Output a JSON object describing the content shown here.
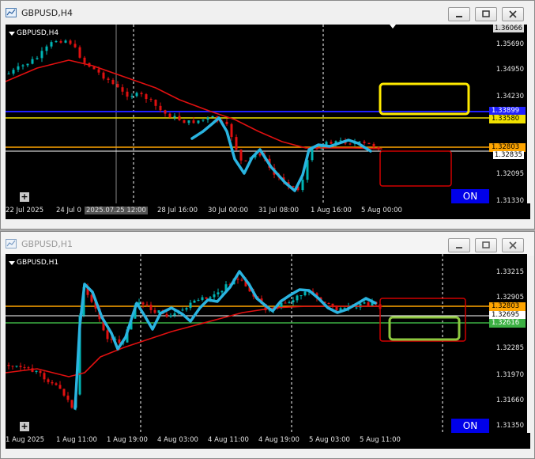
{
  "windows": [
    {
      "title": "GBPUSD,H4",
      "symbol_label": "GBPUSD,H4",
      "price_labels": [
        "1.36066",
        "1.35690",
        "1.34950",
        "1.34230",
        "1.33510",
        "1.32835",
        "1.32095",
        "1.31330"
      ],
      "price_tags": [
        {
          "value": "1.33899",
          "color": "#2020ff"
        },
        {
          "value": "1.33580",
          "color": "#f0e000"
        },
        {
          "value": "1.32803",
          "color": "#ffa500"
        }
      ],
      "time_labels": [
        "22 Jul 2025",
        "24 Jul 0",
        "28 Jul 16:00",
        "30 Jul 00:00",
        "31 Jul 08:00",
        "1 Aug 16:00",
        "5 Aug 00:00"
      ],
      "crosshair_label": "2025.07.25 12:00",
      "on_label": "ON"
    },
    {
      "title": "GBPUSD,H1",
      "symbol_label": "GBPUSD,H1",
      "price_labels": [
        "1.33215",
        "1.32905",
        "1.32695",
        "1.32285",
        "1.31970",
        "1.31660",
        "1.31350"
      ],
      "price_tags": [
        {
          "value": "1.32803",
          "color": "#ffa500"
        },
        {
          "value": "1.32695",
          "color": "#ffffff"
        },
        {
          "value": "1.32616",
          "color": "#3cb043"
        }
      ],
      "time_labels": [
        "1 Aug 2025",
        "1 Aug 11:00",
        "1 Aug 19:00",
        "4 Aug 03:00",
        "4 Aug 11:00",
        "4 Aug 19:00",
        "5 Aug 03:00",
        "5 Aug 11:00"
      ],
      "on_label": "ON"
    }
  ],
  "colors": {
    "bull_candle": "#00b4b4",
    "bear_candle": "#e01010",
    "moving_average": "#e01010",
    "trend_line": "#2ab4e0",
    "yellow_box": "#ffea00",
    "red_box": "#d00000",
    "green_box": "#8dc63f"
  }
}
